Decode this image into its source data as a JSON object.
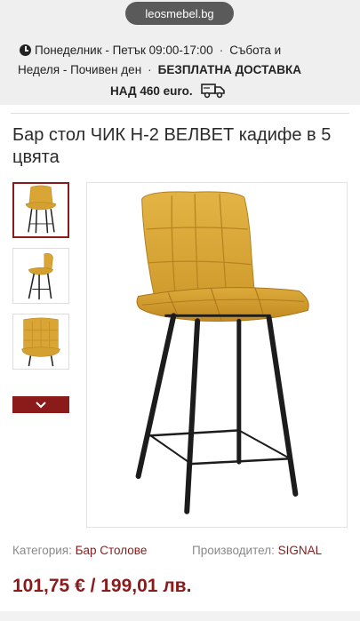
{
  "browser": {
    "url": "leosmebel.bg"
  },
  "info": {
    "schedule_weekdays": "Понеделник - Петък 09:00-17:00",
    "schedule_saturday": "Събота и",
    "schedule_sunday": "Неделя - Почивен ден",
    "free_delivery_a": "БЕЗПЛАТНА ДОСТАВКА",
    "free_delivery_b": "НАД 460 euro.",
    "separator": "·"
  },
  "product": {
    "title": "Бар стол ЧИК Н-2 ВЕЛВЕТ кадифе в 5 цвята",
    "category_label": "Категория:",
    "category_value": "Бар Столове",
    "maker_label": "Производител:",
    "maker_value": "SIGNAL",
    "price": "101,75 € / 199,01 лв."
  },
  "thumbnails": [
    {
      "name": "front view",
      "active": true
    },
    {
      "name": "side view",
      "active": false
    },
    {
      "name": "seat detail",
      "active": false
    }
  ],
  "colors": {
    "accent": "#8b1a1a",
    "velvet": "#d9a535",
    "band": "#efefef"
  },
  "icons": [
    "clock-icon",
    "truck-icon",
    "chevron-down-icon"
  ]
}
